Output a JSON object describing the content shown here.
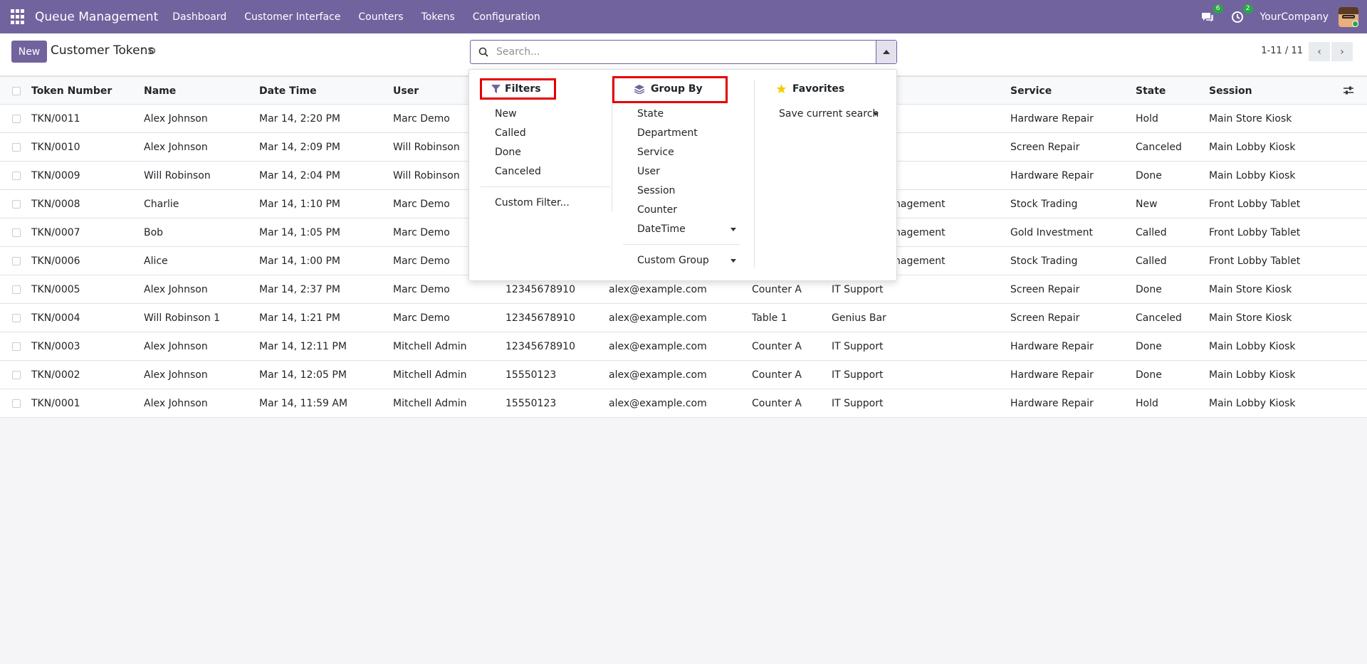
{
  "navbar": {
    "app_name": "Queue Management",
    "menu": [
      "Dashboard",
      "Customer Interface",
      "Counters",
      "Tokens",
      "Configuration"
    ],
    "messages_count": "6",
    "activities_count": "2",
    "company": "YourCompany"
  },
  "control": {
    "new_label": "New",
    "title": "Customer Tokens",
    "search_placeholder": "Search...",
    "pager": "1-11 / 11"
  },
  "table": {
    "headers": [
      "Token Number",
      "Name",
      "Date Time",
      "User",
      "Service",
      "State",
      "Session"
    ],
    "rows": [
      [
        "TKN/0011",
        "Alex Johnson",
        "Mar 14, 2:20 PM",
        "Marc Demo",
        "",
        "",
        "",
        "",
        "Hardware Repair",
        "Hold",
        "Main Store Kiosk"
      ],
      [
        "TKN/0010",
        "Alex Johnson",
        "Mar 14, 2:09 PM",
        "Will Robinson",
        "",
        "",
        "",
        "",
        "Screen Repair",
        "Canceled",
        "Main Lobby Kiosk"
      ],
      [
        "TKN/0009",
        "Will Robinson",
        "Mar 14, 2:04 PM",
        "Will Robinson",
        "",
        "",
        "",
        "",
        "Hardware Repair",
        "Done",
        "Main Lobby Kiosk"
      ],
      [
        "TKN/0008",
        "Charlie",
        "Mar 14, 1:10 PM",
        "Marc Demo",
        "",
        "",
        "",
        "nagement",
        "Stock Trading",
        "New",
        "Front Lobby Tablet"
      ],
      [
        "TKN/0007",
        "Bob",
        "Mar 14, 1:05 PM",
        "Marc Demo",
        "",
        "",
        "",
        "nagement",
        "Gold Investment",
        "Called",
        "Front Lobby Tablet"
      ],
      [
        "TKN/0006",
        "Alice",
        "Mar 14, 1:00 PM",
        "Marc Demo",
        "",
        "",
        "",
        "nagement",
        "Stock Trading",
        "Called",
        "Front Lobby Tablet"
      ],
      [
        "TKN/0005",
        "Alex Johnson",
        "Mar 14, 2:37 PM",
        "Marc Demo",
        "12345678910",
        "alex@example.com",
        "Counter A",
        "IT Support",
        "Screen Repair",
        "Done",
        "Main Store Kiosk"
      ],
      [
        "TKN/0004",
        "Will Robinson 1",
        "Mar 14, 1:21 PM",
        "Marc Demo",
        "12345678910",
        "alex@example.com",
        "Table 1",
        "Genius Bar",
        "Screen Repair",
        "Canceled",
        "Main Store Kiosk"
      ],
      [
        "TKN/0003",
        "Alex Johnson",
        "Mar 14, 12:11 PM",
        "Mitchell Admin",
        "12345678910",
        "alex@example.com",
        "Counter A",
        "IT Support",
        "Hardware Repair",
        "Done",
        "Main Lobby Kiosk"
      ],
      [
        "TKN/0002",
        "Alex Johnson",
        "Mar 14, 12:05 PM",
        "Mitchell Admin",
        "15550123",
        "alex@example.com",
        "Counter A",
        "IT Support",
        "Hardware Repair",
        "Done",
        "Main Lobby Kiosk"
      ],
      [
        "TKN/0001",
        "Alex Johnson",
        "Mar 14, 11:59 AM",
        "Mitchell Admin",
        "15550123",
        "alex@example.com",
        "Counter A",
        "IT Support",
        "Hardware Repair",
        "Hold",
        "Main Lobby Kiosk"
      ]
    ]
  },
  "dropdown": {
    "filters_title": "Filters",
    "filters": [
      "New",
      "Called",
      "Done",
      "Canceled"
    ],
    "custom_filter": "Custom Filter...",
    "groupby_title": "Group By",
    "groupby": [
      "State",
      "Department",
      "Service",
      "User",
      "Session",
      "Counter",
      "DateTime"
    ],
    "custom_group": "Custom Group",
    "favorites_title": "Favorites",
    "save_search": "Save current search"
  },
  "colors": {
    "brand": "#71639e",
    "highlight": "#e50000",
    "badge": "#28a745",
    "star": "#f3cc00"
  }
}
